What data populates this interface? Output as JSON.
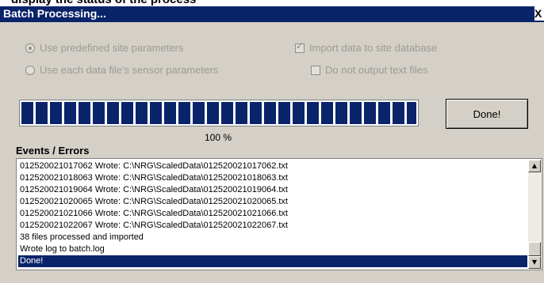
{
  "top_caption": "display the status of the process",
  "window": {
    "title": "Batch Processing...",
    "close_label": "X"
  },
  "options": {
    "predefined_site_params": {
      "label": "Use predefined site parameters",
      "selected": true
    },
    "each_file_sensor_params": {
      "label": "Use each data file's sensor parameters",
      "selected": false
    },
    "import_to_site_db": {
      "label": "Import data to site database",
      "checked": true
    },
    "no_text_output": {
      "label": "Do not output text files",
      "checked": false
    }
  },
  "progress": {
    "value_percent": 100,
    "label": "100 %"
  },
  "done_button": {
    "label": "Done!"
  },
  "events": {
    "label": "Events / Errors",
    "lines": [
      "012520021017062 Wrote: C:\\NRG\\ScaledData\\012520021017062.txt",
      "012520021018063 Wrote: C:\\NRG\\ScaledData\\012520021018063.txt",
      "012520021019064 Wrote: C:\\NRG\\ScaledData\\012520021019064.txt",
      "012520021020065 Wrote: C:\\NRG\\ScaledData\\012520021020065.txt",
      "012520021021066 Wrote: C:\\NRG\\ScaledData\\012520021021066.txt",
      "012520021022067 Wrote: C:\\NRG\\ScaledData\\012520021022067.txt",
      "38 files processed and imported",
      "Wrote log to batch.log",
      "Done!"
    ],
    "selected_index": 8
  },
  "icons": {
    "scroll_up": "scroll-up-arrow-icon",
    "scroll_down": "scroll-down-arrow-icon"
  }
}
